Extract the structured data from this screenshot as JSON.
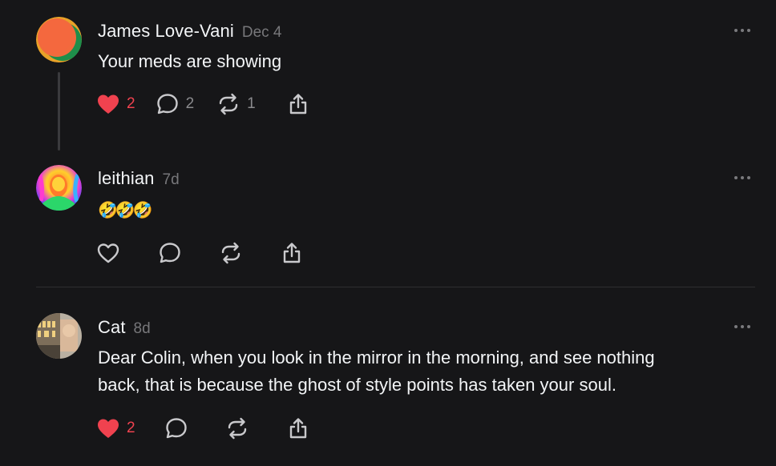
{
  "posts": [
    {
      "author": "James Love-Vani",
      "time": "Dec 4",
      "text": "Your meds are showing",
      "likes": "2",
      "replies": "2",
      "reposts": "1",
      "liked": true
    },
    {
      "author": "leithian",
      "time": "7d",
      "text": "🤣🤣🤣",
      "liked": false
    },
    {
      "author": "Cat",
      "time": "8d",
      "text_line1": "Dear Colin, when you look in the mirror in the morning, and see nothing",
      "text_line2": "back, that is because the ghost of style points has taken your soul.",
      "likes": "2",
      "liked": true
    }
  ],
  "colors": {
    "background": "#161618",
    "like_red": "#f0424f",
    "muted": "#77777a",
    "icon": "#c9c9cc"
  },
  "icons": [
    "heart-icon",
    "comment-icon",
    "repost-icon",
    "share-icon",
    "more-icon"
  ]
}
